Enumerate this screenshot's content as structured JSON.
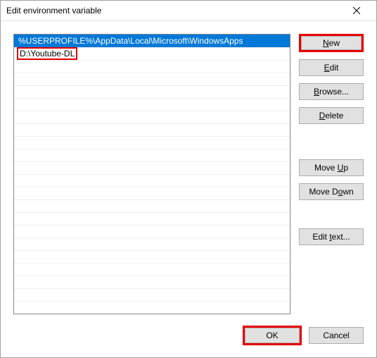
{
  "window": {
    "title": "Edit environment variable"
  },
  "list": {
    "items": [
      {
        "text": "%USERPROFILE%\\AppData\\Local\\Microsoft\\WindowsApps",
        "selected": true,
        "highlighted": false
      },
      {
        "text": "D:\\Youtube-DL",
        "selected": false,
        "highlighted": true
      }
    ]
  },
  "buttons": {
    "new": "New",
    "edit": "Edit",
    "browse": "Browse...",
    "delete": "Delete",
    "move_up": "Move Up",
    "move_down": "Move Down",
    "edit_text": "Edit text...",
    "ok": "OK",
    "cancel": "Cancel"
  }
}
